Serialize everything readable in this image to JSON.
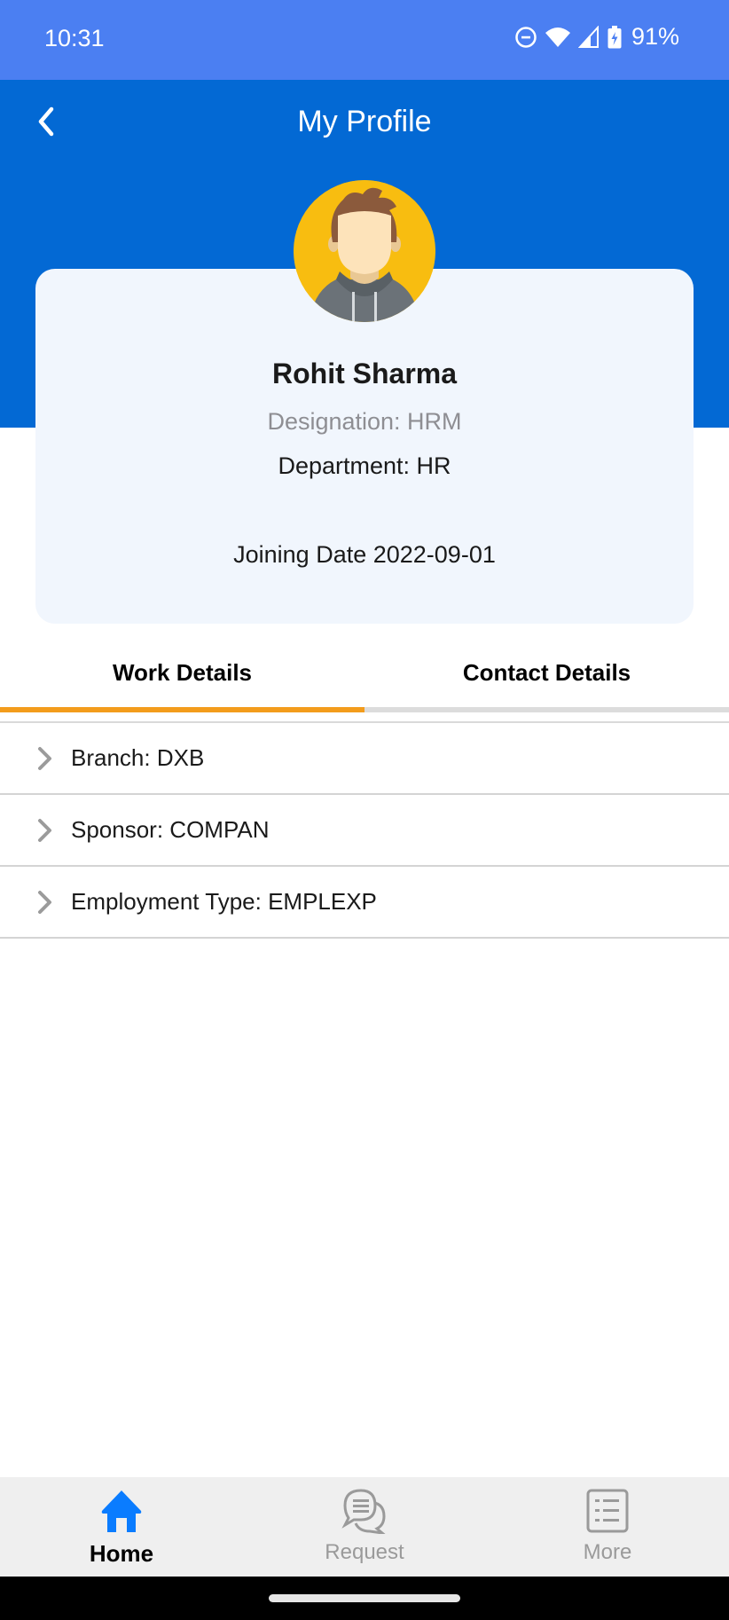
{
  "status_bar": {
    "time": "10:31",
    "battery_percent": "91%",
    "icons": [
      "do-not-disturb-icon",
      "wifi-icon",
      "cellular-signal-icon",
      "battery-charging-icon"
    ]
  },
  "header": {
    "title": "My Profile",
    "back_icon": "chevron-left-icon"
  },
  "profile": {
    "avatar_icon": "user-avatar-illustration",
    "name": "Rohit Sharma",
    "designation": "Designation: HRM",
    "department": "Department: HR",
    "joining_date": "Joining Date 2022-09-01"
  },
  "tabs": {
    "items": [
      {
        "label": "Work Details",
        "active": true
      },
      {
        "label": "Contact Details",
        "active": false
      }
    ]
  },
  "work_details": {
    "items": [
      {
        "label": "Branch: DXB"
      },
      {
        "label": "Sponsor: COMPAN"
      },
      {
        "label": "Employment Type: EMPLEXP"
      }
    ]
  },
  "bottom_nav": {
    "items": [
      {
        "label": "Home",
        "icon": "home-icon",
        "active": true
      },
      {
        "label": "Request",
        "icon": "chat-bubbles-icon",
        "active": false
      },
      {
        "label": "More",
        "icon": "list-icon",
        "active": false
      }
    ]
  },
  "colors": {
    "status_bar": "#4b7ff2",
    "header": "#0369d4",
    "card_bg": "#f1f6fd",
    "tab_indicator": "#f39c1c",
    "nav_active": "#0a7cff",
    "nav_inactive": "#9a9a9a"
  }
}
